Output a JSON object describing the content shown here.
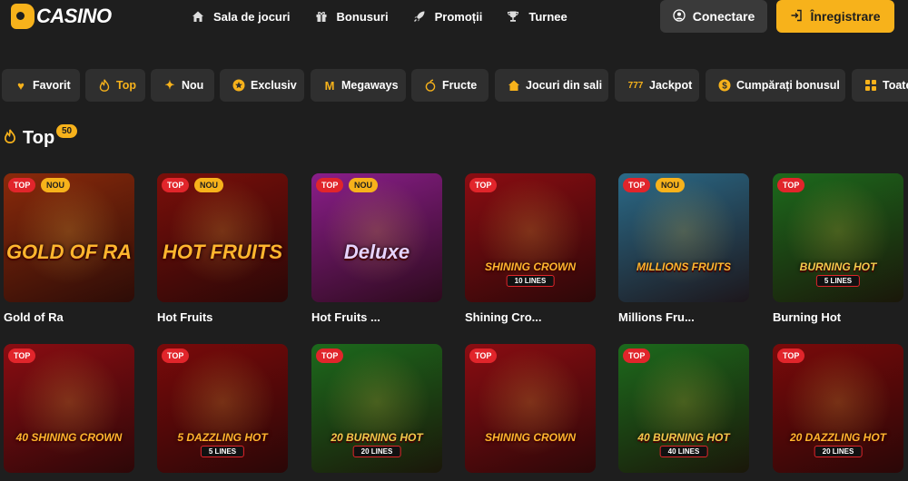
{
  "brand": {
    "logo_text": "CASINO",
    "accent": "#f7b21b"
  },
  "nav": {
    "items": [
      {
        "label": "Sala de jocuri",
        "icon": "home-icon"
      },
      {
        "label": "Bonusuri",
        "icon": "gift-icon"
      },
      {
        "label": "Promoții",
        "icon": "rocket-icon"
      },
      {
        "label": "Turnee",
        "icon": "trophy-icon"
      }
    ],
    "login_label": "Conectare",
    "register_label": "Înregistrare"
  },
  "categories": [
    {
      "label": "Favorit",
      "icon": "heart-icon",
      "active": false
    },
    {
      "label": "Top",
      "icon": "flame-icon",
      "active": true
    },
    {
      "label": "Nou",
      "icon": "sparkle-icon",
      "active": false
    },
    {
      "label": "Exclusiv",
      "icon": "star-icon",
      "active": false
    },
    {
      "label": "Megaways",
      "icon": "megaways-icon",
      "active": false
    },
    {
      "label": "Fructe",
      "icon": "fruit-icon",
      "active": false
    },
    {
      "label": "Jocuri din sali",
      "icon": "house-icon",
      "active": false
    },
    {
      "label": "Jackpot",
      "icon": "jackpot-icon",
      "active": false
    },
    {
      "label": "Cumpărați bonusul",
      "icon": "dollar-icon",
      "active": false
    },
    {
      "label": "Toate",
      "icon": "grid-icon",
      "active": false
    }
  ],
  "section": {
    "title": "Top",
    "count": "50"
  },
  "badges": {
    "top": "TOP",
    "new": "NOU"
  },
  "games": [
    {
      "caption": "Gold of Ra",
      "art_title": "GOLD OF RA",
      "art_sub": "",
      "badges": [
        "top",
        "new"
      ],
      "bg": "#8a2a0b"
    },
    {
      "caption": "Hot Fruits",
      "art_title": "HOT FRUITS",
      "art_sub": "",
      "badges": [
        "top",
        "new"
      ],
      "bg": "#7a0f0a"
    },
    {
      "caption": "Hot Fruits ...",
      "art_title": "Deluxe",
      "art_sub": "",
      "badges": [
        "top",
        "new"
      ],
      "bg": "#8a1e8a"
    },
    {
      "caption": "Shining Cro...",
      "art_title": "SHINING CROWN",
      "art_sub": "10 LINES",
      "badges": [
        "top"
      ],
      "bg": "#8a0d12"
    },
    {
      "caption": "Millions Fru...",
      "art_title": "MILLIONS FRUITS",
      "art_sub": "",
      "badges": [
        "top",
        "new"
      ],
      "bg": "#2a6a88"
    },
    {
      "caption": "Burning Hot",
      "art_title": "BURNING HOT",
      "art_sub": "5 LINES",
      "badges": [
        "top"
      ],
      "bg": "#1c6a1c"
    },
    {
      "caption": "",
      "art_title": "40 SHINING CROWN",
      "art_sub": "",
      "badges": [
        "top"
      ],
      "bg": "#8a0d12"
    },
    {
      "caption": "",
      "art_title": "5 DAZZLING HOT",
      "art_sub": "5 LINES",
      "badges": [
        "top"
      ],
      "bg": "#7a0a0a"
    },
    {
      "caption": "",
      "art_title": "20 BURNING HOT",
      "art_sub": "20 LINES",
      "badges": [
        "top"
      ],
      "bg": "#1c6a1c"
    },
    {
      "caption": "",
      "art_title": "SHINING CROWN",
      "art_sub": "",
      "badges": [
        "top"
      ],
      "bg": "#8a0d12"
    },
    {
      "caption": "",
      "art_title": "40 BURNING HOT",
      "art_sub": "40 LINES",
      "badges": [
        "top"
      ],
      "bg": "#1c6a1c"
    },
    {
      "caption": "",
      "art_title": "20 DAZZLING HOT",
      "art_sub": "20 LINES",
      "badges": [
        "top"
      ],
      "bg": "#7a0a0a"
    }
  ]
}
